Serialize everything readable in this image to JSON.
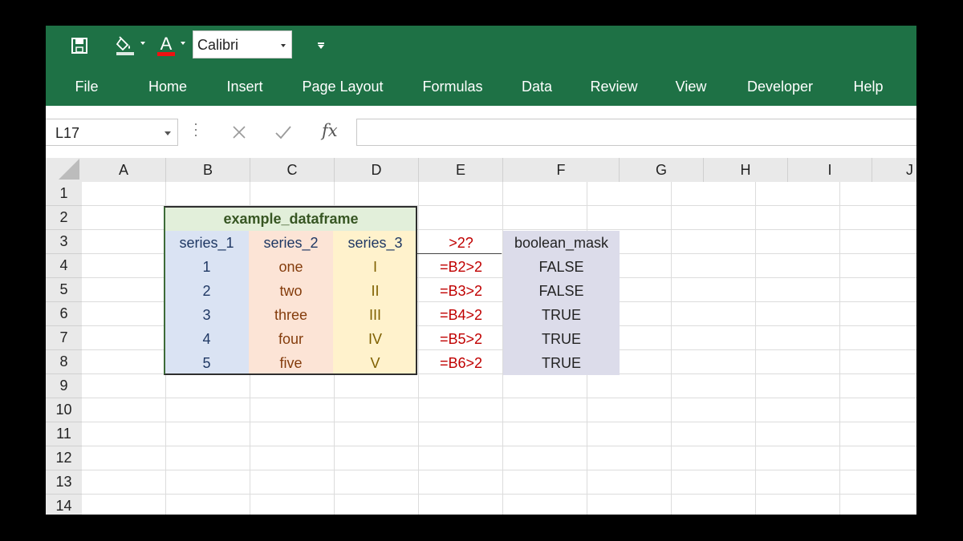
{
  "ribbon": {
    "font_name": "Calibri",
    "tabs": [
      "File",
      "Home",
      "Insert",
      "Page Layout",
      "Formulas",
      "Data",
      "Review",
      "View",
      "Developer",
      "Help"
    ],
    "bg_color": "#1e7145"
  },
  "formula_bar": {
    "name_box": "L17",
    "fx": "fx",
    "formula": ""
  },
  "columns": [
    "A",
    "B",
    "C",
    "D",
    "E",
    "F",
    "G",
    "H",
    "I",
    "J"
  ],
  "rows": [
    "1",
    "2",
    "3",
    "4",
    "5",
    "6",
    "7",
    "8",
    "9",
    "10",
    "11",
    "12",
    "13",
    "14"
  ],
  "sheet": {
    "title": "example_dataframe",
    "headers": [
      "series_1",
      "series_2",
      "series_3"
    ],
    "series_1": [
      "1",
      "2",
      "3",
      "4",
      "5"
    ],
    "series_2": [
      "one",
      "two",
      "three",
      "four",
      "five"
    ],
    "series_3": [
      "I",
      "II",
      "III",
      "IV",
      "V"
    ],
    "e_header": ">2?",
    "formulas": [
      "=B2>2",
      "=B3>2",
      "=B4>2",
      "=B5>2",
      "=B6>2"
    ],
    "mask_header": "boolean_mask",
    "mask": [
      "FALSE",
      "FALSE",
      "TRUE",
      "TRUE",
      "TRUE"
    ]
  },
  "colors": {
    "series_1_fill": "#dae3f3",
    "series_2_fill": "#fce4d6",
    "series_3_fill": "#fff2cc",
    "title_fill": "#e2efda",
    "mask_fill": "#dcdcea",
    "formula_text": "#c00000"
  }
}
